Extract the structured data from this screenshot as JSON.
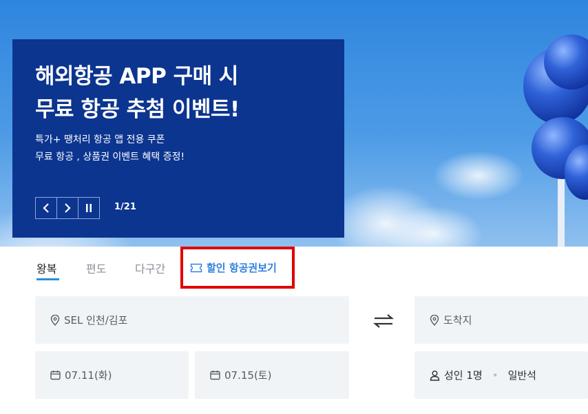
{
  "promo": {
    "title_line1": "해외항공 APP 구매 시",
    "title_line2": "무료 항공 추첨 이벤트!",
    "sub_line1": "특가+ 땡처리 항공 앱 전용 쿠폰",
    "sub_line2": "무료 항공 , 상품권 이벤트 혜택 증정!",
    "counter": "1/21"
  },
  "tabs": [
    {
      "label": "왕복"
    },
    {
      "label": "편도"
    },
    {
      "label": "다구간"
    }
  ],
  "discount_link": "할인 항공권보기",
  "search": {
    "origin": "SEL 인천/김포",
    "destination": "도착지",
    "depart_date": "07.11(화)",
    "return_date": "07.15(토)",
    "passengers": "성인 1명",
    "cabin": "일반석"
  },
  "colors": {
    "accent": "#2f7fe0",
    "promo_bg": "#0c3590",
    "highlight_box": "#e00000",
    "field_bg": "#f1f4f7"
  },
  "icons": [
    "chevron-left-icon",
    "chevron-right-icon",
    "pause-icon",
    "ticket-icon",
    "location-pin-icon",
    "swap-arrows-icon",
    "calendar-icon",
    "person-icon"
  ]
}
